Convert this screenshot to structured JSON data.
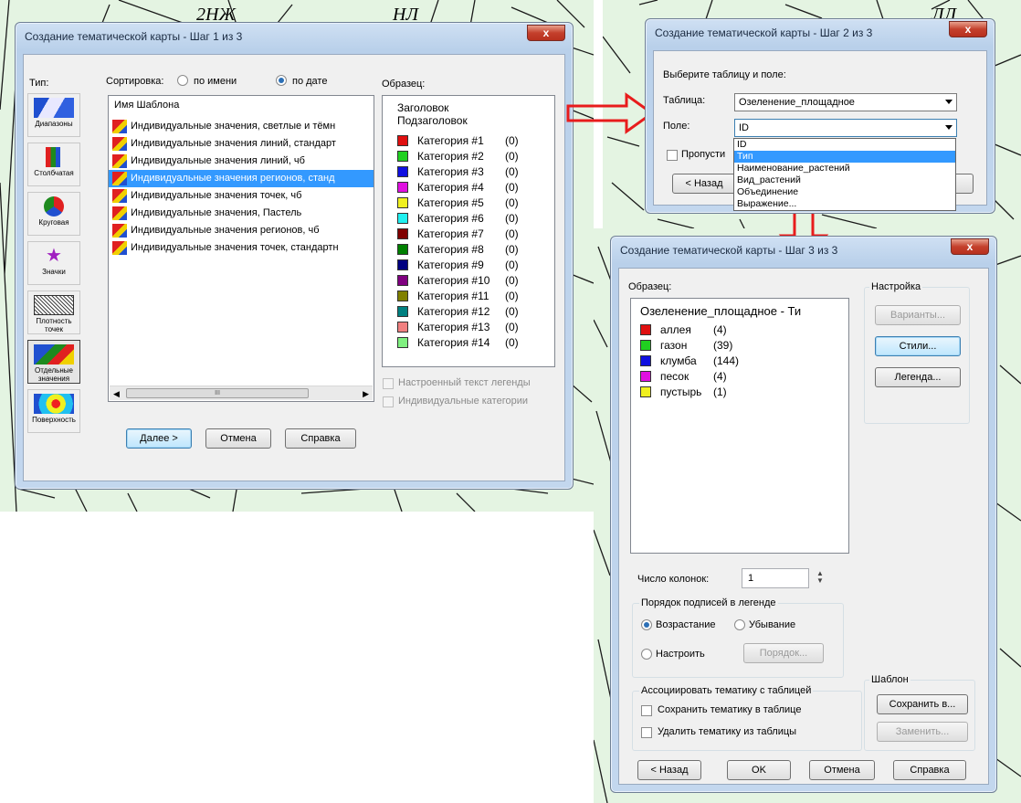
{
  "dialog1": {
    "title": "Создание тематической карты - Шаг 1 из 3",
    "close": "x",
    "type_label": "Тип:",
    "sort_label": "Сортировка:",
    "sort_by_name": "по имени",
    "sort_by_date": "по дате",
    "sort_selected": "date",
    "template_header": "Имя Шаблона",
    "types": [
      {
        "label": "Диапазоны",
        "icon": "ranges-icon",
        "selected": false
      },
      {
        "label": "Столбчатая",
        "icon": "bar-chart-icon",
        "selected": false
      },
      {
        "label": "Круговая",
        "icon": "pie-chart-icon",
        "selected": false
      },
      {
        "label": "Значки",
        "icon": "symbols-icon",
        "selected": false
      },
      {
        "label": "Плотность точек",
        "icon": "dot-density-icon",
        "selected": false
      },
      {
        "label": "Отдельные значения",
        "icon": "individual-values-icon",
        "selected": true
      },
      {
        "label": "Поверхность",
        "icon": "surface-icon",
        "selected": false
      }
    ],
    "templates": [
      {
        "label": "Индивидуальные значения, светлые и тёмн",
        "selected": false
      },
      {
        "label": "Индивидуальные значения линий, стандарт",
        "selected": false
      },
      {
        "label": "Индивидуальные значения линий, чб",
        "selected": false
      },
      {
        "label": "Индивидуальные значения регионов, станд",
        "selected": true
      },
      {
        "label": "Индивидуальные значения точек, чб",
        "selected": false
      },
      {
        "label": "Индивидуальные значения, Пастель",
        "selected": false
      },
      {
        "label": "Индивидуальные значения регионов, чб",
        "selected": false
      },
      {
        "label": "Индивидуальные значения точек, стандартн",
        "selected": false
      }
    ],
    "sample_label": "Образец:",
    "sample_title": "Заголовок",
    "sample_subtitle": "Подзаголовок",
    "categories": [
      {
        "label": "Категория #1",
        "count": "(0)",
        "color": "#e01010"
      },
      {
        "label": "Категория #2",
        "count": "(0)",
        "color": "#20d020"
      },
      {
        "label": "Категория #3",
        "count": "(0)",
        "color": "#1010e0"
      },
      {
        "label": "Категория #4",
        "count": "(0)",
        "color": "#e010e0"
      },
      {
        "label": "Категория #5",
        "count": "(0)",
        "color": "#f0f020"
      },
      {
        "label": "Категория #6",
        "count": "(0)",
        "color": "#20f0f0"
      },
      {
        "label": "Категория #7",
        "count": "(0)",
        "color": "#800000"
      },
      {
        "label": "Категория #8",
        "count": "(0)",
        "color": "#008000"
      },
      {
        "label": "Категория #9",
        "count": "(0)",
        "color": "#000080"
      },
      {
        "label": "Категория #10",
        "count": "(0)",
        "color": "#800080"
      },
      {
        "label": "Категория #11",
        "count": "(0)",
        "color": "#808000"
      },
      {
        "label": "Категория #12",
        "count": "(0)",
        "color": "#008080"
      },
      {
        "label": "Категория #13",
        "count": "(0)",
        "color": "#f08080"
      },
      {
        "label": "Категория #14",
        "count": "(0)",
        "color": "#80f080"
      }
    ],
    "custom_legend_text": "Настроенный текст легенды",
    "individual_categories": "Индивидуальные категории",
    "scroll_mark": "III",
    "btn_next": "Далее >",
    "btn_cancel": "Отмена",
    "btn_help": "Справка"
  },
  "dialog2": {
    "title": "Создание тематической карты - Шаг 2 из 3",
    "close": "x",
    "instruction": "Выберите таблицу и поле:",
    "table_label": "Таблица:",
    "table_value": "Озеленение_площадное",
    "field_label": "Поле:",
    "field_value": "ID",
    "field_options": [
      "ID",
      "Тип",
      "Наименование_растений",
      "Вид_растений",
      "Объединение",
      "Выражение..."
    ],
    "field_highlighted": 1,
    "skip_label": "Пропусти",
    "btn_back": "< Назад"
  },
  "dialog3": {
    "title": "Создание тематической карты - Шаг 3 из 3",
    "close": "x",
    "sample_label": "Образец:",
    "legend_title": "Озеленение_площадное - Ти",
    "legend_items": [
      {
        "label": "аллея",
        "count": "(4)",
        "color": "#e01010"
      },
      {
        "label": "газон",
        "count": "(39)",
        "color": "#20d020"
      },
      {
        "label": "клумба",
        "count": "(144)",
        "color": "#1010e0"
      },
      {
        "label": "песок",
        "count": "(4)",
        "color": "#e010e0"
      },
      {
        "label": "пустырь",
        "count": "(1)",
        "color": "#f0f020"
      }
    ],
    "settings_label": "Настройка",
    "btn_variants": "Варианты...",
    "btn_styles": "Стили...",
    "btn_legend": "Легенда...",
    "columns_label": "Число колонок:",
    "columns_value": "1",
    "order_group": "Порядок подписей в легенде",
    "order_asc": "Возрастание",
    "order_desc": "Убывание",
    "order_custom": "Настроить",
    "order_selected": "asc",
    "btn_order": "Порядок...",
    "assoc_group": "Ассоциировать тематику с таблицей",
    "save_in_table": "Сохранить тематику в таблице",
    "remove_from_table": "Удалить тематику из таблицы",
    "template_group": "Шаблон",
    "btn_save_to": "Сохранить в...",
    "btn_replace": "Заменить...",
    "btn_back": "< Назад",
    "btn_ok": "OK",
    "btn_cancel": "Отмена",
    "btn_help": "Справка"
  },
  "map_labels": {
    "m1": "2НЖ",
    "m2": "НЛ",
    "m3": "ЛЛ"
  },
  "colors": {
    "arrow": "#e81c1c",
    "map_line": "#1a1a1a",
    "map_bg": "#e4f4e2",
    "selection": "#3399ff"
  }
}
